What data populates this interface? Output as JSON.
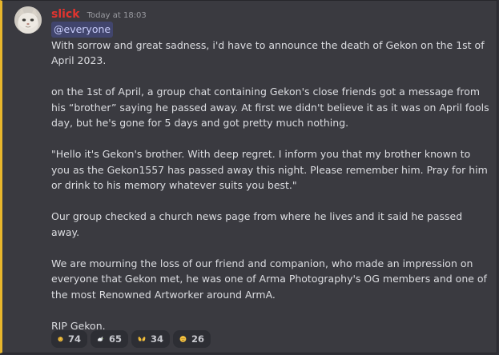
{
  "message": {
    "username": "slick",
    "timestamp": "Today at 18:03",
    "mention": "@everyone",
    "paragraphs": [
      "With sorrow and great sadness, i'd have to announce the death of Gekon on the 1st of April 2023.",
      "on the 1st of April, a group chat containing Gekon's close friends got a message from his “brother” saying he passed away. At first we didn't believe it as it was on April fools day, but he's gone for 5 days and got pretty much nothing.",
      "\"Hello it's Gekon's brother. With deep regret. I inform you that my brother known to you as the Gekon1557 has passed away this night. Please remember him. Pray for him or drink to his memory whatever suits you best.\"",
      "Our group checked a church news page from where he lives and it said he passed away.",
      "We are mourning the loss of our friend and companion, who made an impression on everyone that Gekon met, he was one of Arma Photography's OG members and one of the most Renowned Artworker around ArmA.",
      "RIP Gekon."
    ]
  },
  "reactions": [
    {
      "emoji": "saluting-face",
      "count": "74"
    },
    {
      "emoji": "dove",
      "count": "65"
    },
    {
      "emoji": "open-hands",
      "count": "34"
    },
    {
      "emoji": "crying-face",
      "count": "26"
    }
  ],
  "colors": {
    "username": "#e0342f",
    "mention_bg": "#41456d",
    "highlight_bar": "#e8b62c",
    "message_bg": "#3a3a40"
  }
}
